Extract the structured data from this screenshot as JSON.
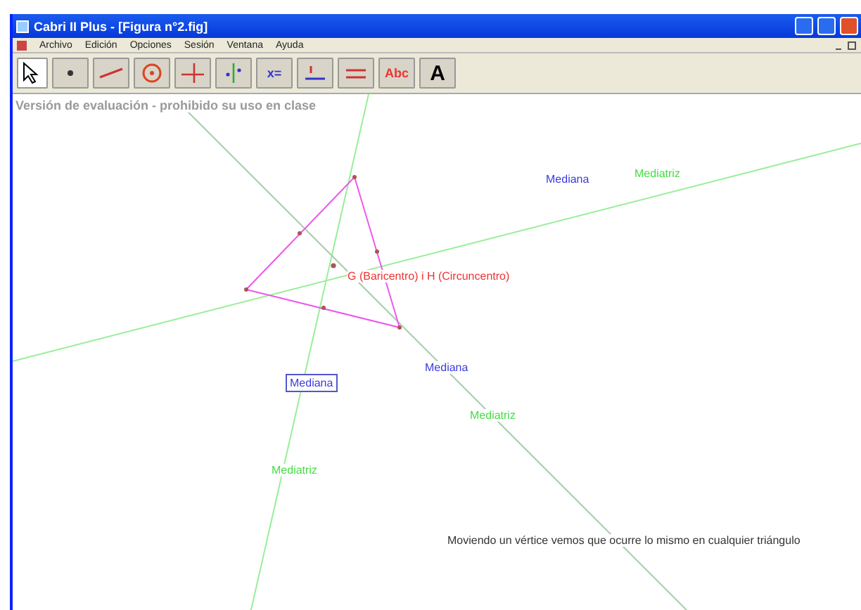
{
  "window": {
    "title": "Cabri II Plus - [Figura n°2.fig]"
  },
  "menu": [
    "Archivo",
    "Edición",
    "Opciones",
    "Sesión",
    "Ventana",
    "Ayuda"
  ],
  "toolbar": [
    {
      "kind": "pointer",
      "selected": true
    },
    {
      "kind": "point",
      "selected": false
    },
    {
      "kind": "line",
      "selected": false
    },
    {
      "kind": "circle",
      "selected": false
    },
    {
      "kind": "perpendicular",
      "selected": false
    },
    {
      "kind": "symmetry",
      "selected": false
    },
    {
      "kind": "calculate",
      "selected": false,
      "glyph": "x="
    },
    {
      "kind": "measure",
      "selected": false
    },
    {
      "kind": "macro",
      "selected": false
    },
    {
      "kind": "text",
      "selected": false,
      "glyph": "Abc"
    },
    {
      "kind": "attribute",
      "selected": false,
      "glyph": "A"
    }
  ],
  "notice": "Versión de evaluación - prohibido su uso en clase",
  "labels": [
    {
      "kind": "median",
      "text": "Mediana",
      "boxed": false
    },
    {
      "kind": "bisector",
      "text": "Mediatriz",
      "boxed": false
    },
    {
      "kind": "point",
      "text": "G (Baricentro) i H (Circuncentro)",
      "boxed": false
    },
    {
      "kind": "median",
      "text": "Mediana",
      "boxed": true
    },
    {
      "kind": "median",
      "text": "Mediana",
      "boxed": false
    },
    {
      "kind": "bisector",
      "text": "Mediatriz",
      "boxed": false
    },
    {
      "kind": "bisector",
      "text": "Mediatriz",
      "boxed": false
    },
    {
      "kind": "comment",
      "text": "Moviendo un vértice vemos que ocurre lo mismo en cualquier triángulo",
      "boxed": false
    }
  ]
}
